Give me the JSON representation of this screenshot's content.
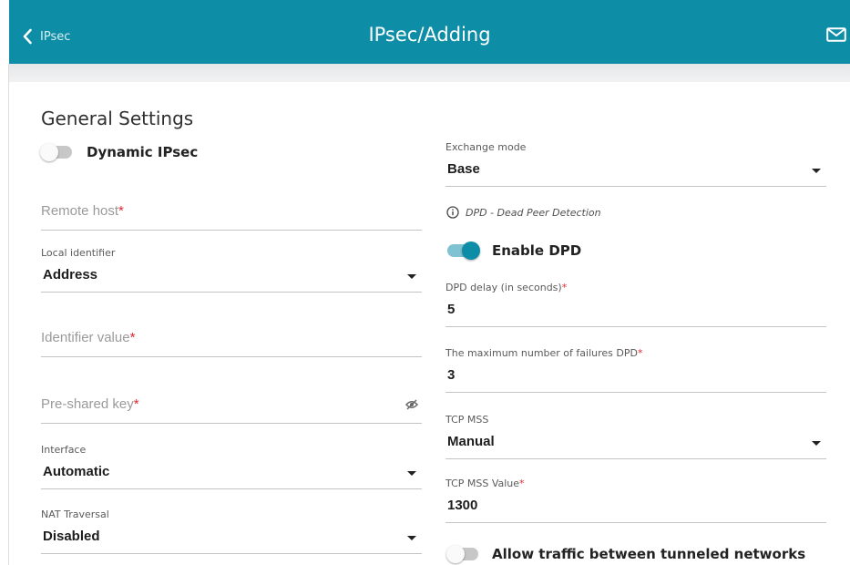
{
  "header": {
    "back_label": "IPsec",
    "title": "IPsec/Adding"
  },
  "general": {
    "section_title": "General Settings",
    "dynamic_ipsec": {
      "label": "Dynamic IPsec",
      "enabled": false
    },
    "remote_host": {
      "placeholder": "Remote host",
      "required": "*"
    },
    "local_identifier": {
      "label": "Local identifier",
      "value": "Address"
    },
    "identifier_value": {
      "placeholder": "Identifier value",
      "required": "*"
    },
    "pre_shared_key": {
      "placeholder": "Pre-shared key",
      "required": "*"
    },
    "interface": {
      "label": "Interface",
      "value": "Automatic"
    },
    "nat_traversal": {
      "label": "NAT Traversal",
      "value": "Disabled"
    }
  },
  "right": {
    "exchange_mode": {
      "label": "Exchange mode",
      "value": "Base"
    },
    "dpd_info": "DPD - Dead Peer Detection",
    "enable_dpd": {
      "label": "Enable DPD",
      "enabled": true
    },
    "dpd_delay": {
      "label": "DPD delay (in seconds)",
      "required": "*",
      "value": "5"
    },
    "max_failures": {
      "label": "The maximum number of failures DPD",
      "required": "*",
      "value": "3"
    },
    "tcp_mss": {
      "label": "TCP MSS",
      "value": "Manual"
    },
    "tcp_mss_value": {
      "label": "TCP MSS Value",
      "required": "*",
      "value": "1300"
    },
    "allow_traffic": {
      "label": "Allow traffic between tunneled networks",
      "enabled": false
    }
  },
  "colors": {
    "header_bg": "#0e8ea6",
    "accent": "#0e8ea6",
    "required": "#e0282e"
  }
}
